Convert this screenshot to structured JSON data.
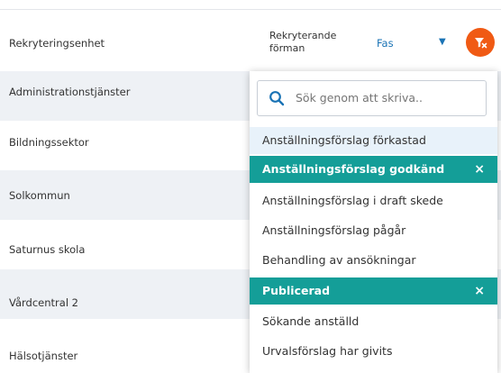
{
  "header": {
    "col_unit": "Rekryteringsenhet",
    "col_manager_line1": "Rekryterande",
    "col_manager_line2": "förman",
    "col_phase": "Fas"
  },
  "rows": [
    {
      "label": "Administrationstjänster"
    },
    {
      "label": "Bildningssektor"
    },
    {
      "label": "Solkommun"
    },
    {
      "label": "Saturnus skola"
    },
    {
      "label": "Vårdcentral 2"
    },
    {
      "label": "Hälsotjänster"
    }
  ],
  "dropdown": {
    "search_placeholder": "Sök genom att skriva..",
    "options": [
      {
        "label": "Anställningsförslag förkastad",
        "state": "hover"
      },
      {
        "label": "Anställningsförslag godkänd",
        "state": "selected"
      },
      {
        "label": "Anställningsförslag i draft skede",
        "state": "normal"
      },
      {
        "label": "Anställningsförslag pågår",
        "state": "normal"
      },
      {
        "label": "Behandling av ansökningar",
        "state": "normal"
      },
      {
        "label": "Publicerad",
        "state": "selected"
      },
      {
        "label": "Sökande anställd",
        "state": "normal"
      },
      {
        "label": "Urvalsförslag har givits",
        "state": "normal"
      }
    ],
    "remove_symbol": "×"
  },
  "icons": {
    "filter": "filter-remove-icon",
    "caret": "caret-down-icon",
    "search": "search-icon"
  },
  "colors": {
    "accent_orange": "#f05a14",
    "selected_teal": "#149e98",
    "link_blue": "#1a73b5",
    "row_shade": "#eef1f5"
  }
}
